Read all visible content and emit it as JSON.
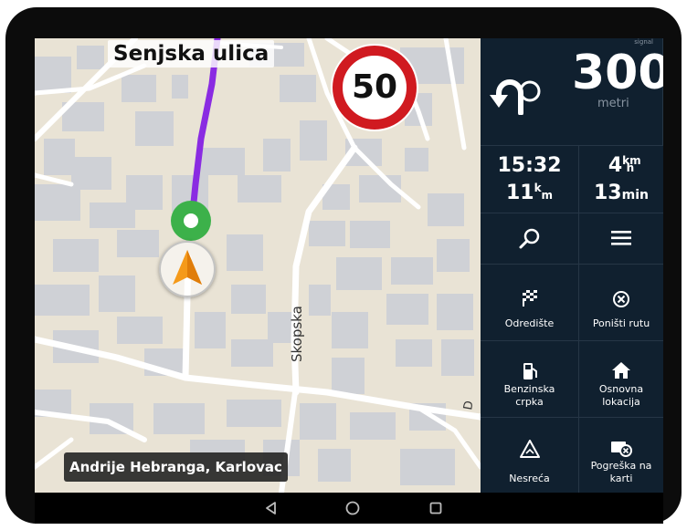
{
  "map": {
    "current_street": "Senjska ulica",
    "current_address": "Andrije Hebranga, Karlovac",
    "road_label": "Skopska",
    "speed_limit": "50",
    "road_edge_label": "D"
  },
  "panel": {
    "corner_label": "signal",
    "turn_icon": "u-turn-left-icon",
    "distance_value": "300",
    "distance_unit": "metri",
    "arrival_time": "15:32",
    "remaining_km_value": "4",
    "remaining_km_unit": "km",
    "remaining_h_unit": "h",
    "trip_distance_value": "11",
    "trip_distance_sup": "k",
    "trip_distance_sub": "m",
    "trip_time_value": "13",
    "trip_time_unit": "min",
    "buttons": {
      "search": "search-icon",
      "menu": "menu-icon",
      "destination": "Odredište",
      "cancel_route": "Poništi rutu",
      "fuel_line1": "Benzinska",
      "fuel_line2": "crpka",
      "home_line1": "Osnovna",
      "home_line2": "lokacija",
      "accident": "Nesreća",
      "map_error_line1": "Pogreška na",
      "map_error_line2": "karti"
    }
  },
  "navbar": {
    "back": "back-icon",
    "home": "home-circle-icon",
    "recents": "recents-icon"
  },
  "colors": {
    "route": "#8a2be2",
    "panel_bg": "#10202f",
    "speed_ring": "#d01a20",
    "position_arrow": "#f59a1a",
    "start_pin": "#3cb14a"
  }
}
